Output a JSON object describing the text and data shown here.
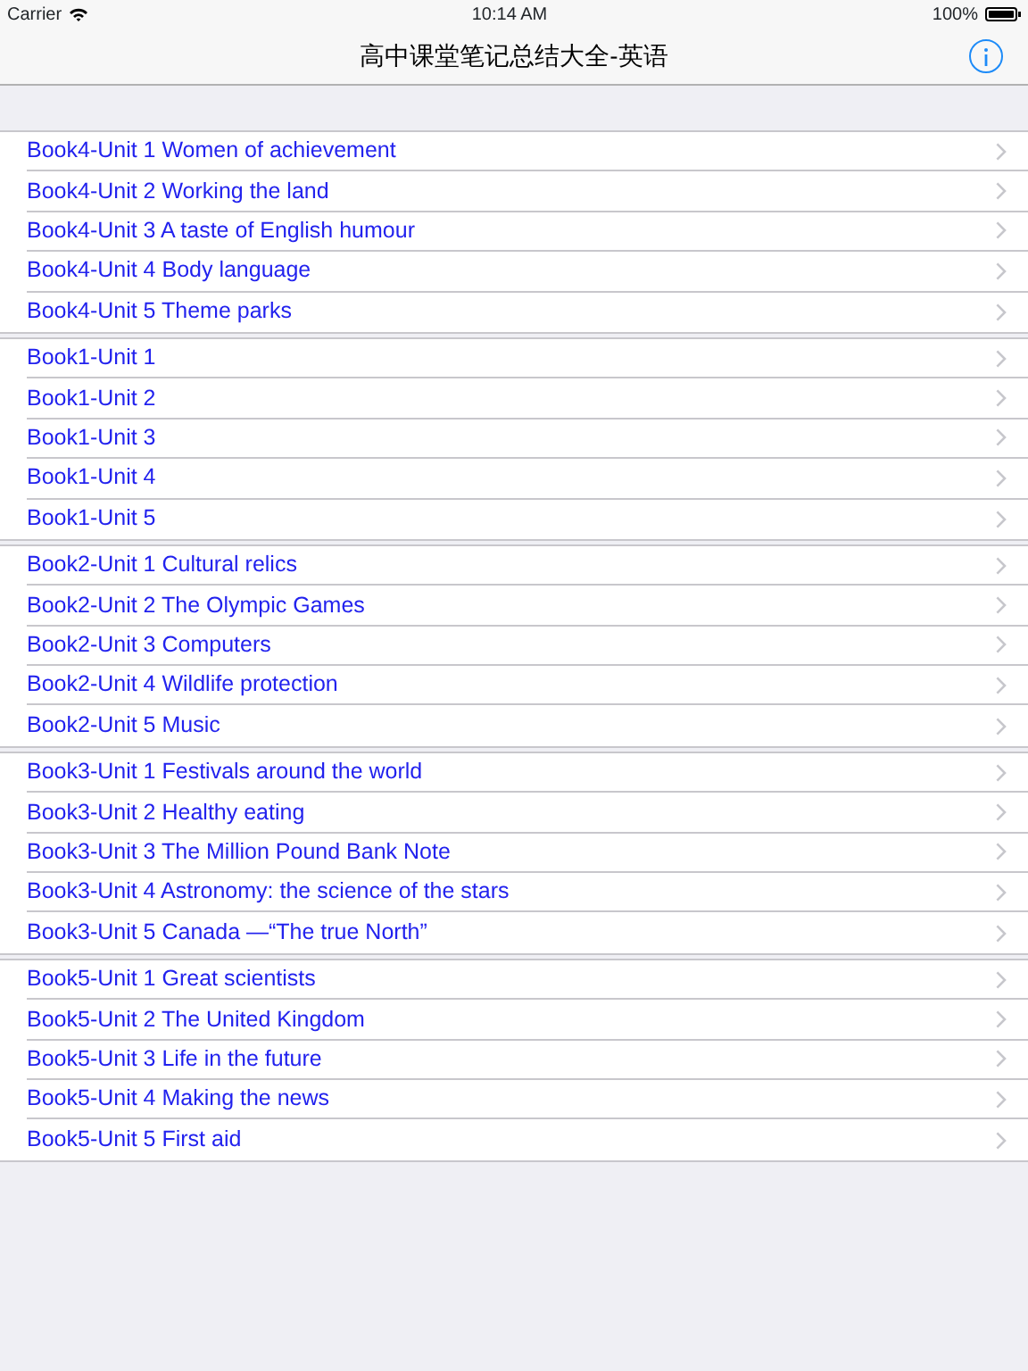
{
  "status_bar": {
    "carrier": "Carrier",
    "time": "10:14 AM",
    "battery": "100%"
  },
  "nav_bar": {
    "title": "高中课堂笔记总结大全-英语"
  },
  "sections": [
    {
      "rows": [
        "Book4-Unit 1 Women of achievement",
        "Book4-Unit 2 Working the land",
        "Book4-Unit 3 A taste of English humour",
        "Book4-Unit 4 Body language",
        "Book4-Unit 5 Theme parks"
      ]
    },
    {
      "rows": [
        "Book1-Unit 1",
        "Book1-Unit 2",
        "Book1-Unit 3",
        "Book1-Unit 4",
        "Book1-Unit 5"
      ]
    },
    {
      "rows": [
        "Book2-Unit 1 Cultural relics",
        "Book2-Unit 2 The Olympic Games",
        "Book2-Unit 3 Computers",
        "Book2-Unit 4 Wildlife protection",
        "Book2-Unit 5 Music"
      ]
    },
    {
      "rows": [
        "Book3-Unit 1 Festivals around the world",
        "Book3-Unit 2 Healthy eating",
        "Book3-Unit 3 The Million Pound Bank Note",
        "Book3-Unit 4 Astronomy: the science of the stars",
        "Book3-Unit 5 Canada —“The true North”"
      ]
    },
    {
      "rows": [
        "Book5-Unit 1 Great scientists",
        "Book5-Unit 2 The United Kingdom",
        "Book5-Unit 3 Life in the future",
        "Book5-Unit 4 Making the news",
        "Book5-Unit 5 First aid"
      ]
    }
  ]
}
